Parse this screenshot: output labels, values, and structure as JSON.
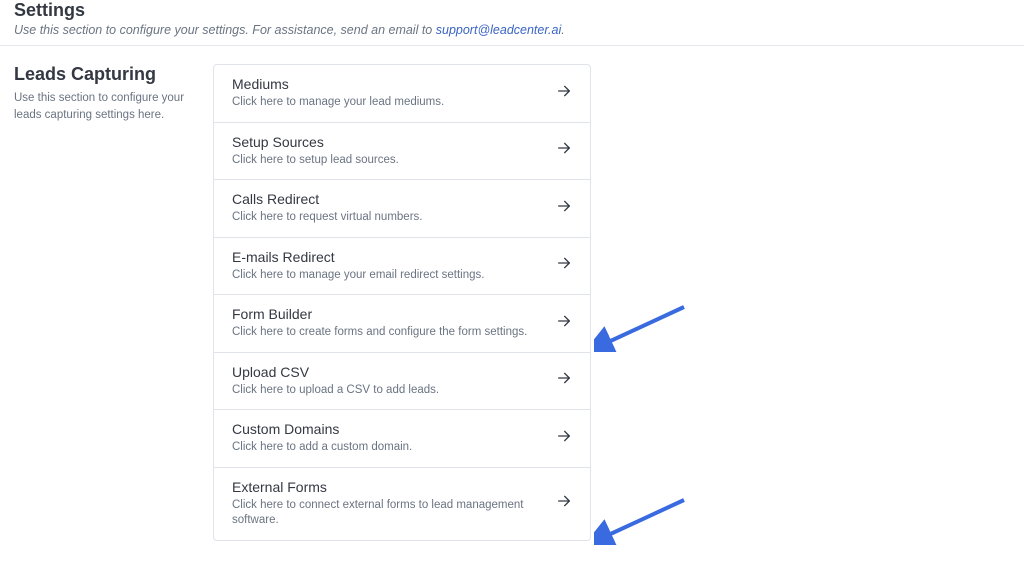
{
  "header": {
    "title": "Settings",
    "subtitle_prefix": "Use this section to configure your settings. For assistance, send an email to ",
    "support_email": "support@leadcenter.ai",
    "subtitle_suffix": "."
  },
  "section": {
    "title": "Leads Capturing",
    "subtitle": "Use this section to configure your leads capturing settings here."
  },
  "rows": [
    {
      "title": "Mediums",
      "desc": "Click here to manage your lead mediums."
    },
    {
      "title": "Setup Sources",
      "desc": "Click here to setup lead sources."
    },
    {
      "title": "Calls Redirect",
      "desc": "Click here to request virtual numbers."
    },
    {
      "title": "E-mails Redirect",
      "desc": "Click here to manage your email redirect settings."
    },
    {
      "title": "Form Builder",
      "desc": "Click here to create forms and configure the form settings."
    },
    {
      "title": "Upload CSV",
      "desc": "Click here to upload a CSV to add leads."
    },
    {
      "title": "Custom Domains",
      "desc": "Click here to add a custom domain."
    },
    {
      "title": "External Forms",
      "desc": "Click here to connect external forms to lead management software."
    }
  ]
}
